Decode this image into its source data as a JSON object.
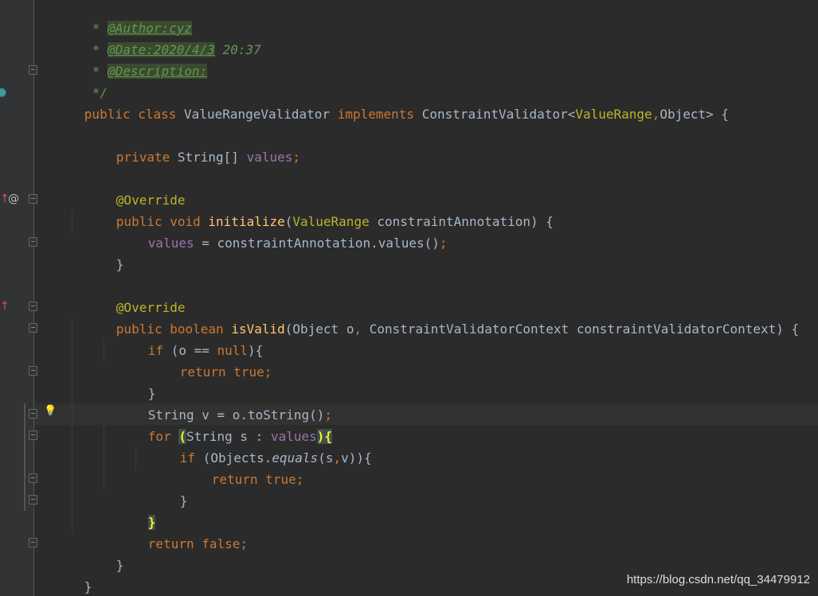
{
  "editor": {
    "doc": {
      "star": "*",
      "author_tag": "@Author:cyz",
      "date_tag": "@Date:2020/4/3",
      "date_time": " 20:37",
      "desc_tag": "@Description:",
      "close": "*/"
    },
    "class_decl": {
      "public": "public",
      "class": "class",
      "name": "ValueRangeValidator",
      "implements": "implements",
      "iface": "ConstraintValidator",
      "lt": "<",
      "type1": "ValueRange",
      "comma": ",",
      "type2": "Object",
      "gt_brace": "> {"
    },
    "field": {
      "private": "private",
      "type": "String[]",
      "name": "values",
      "semi": ";"
    },
    "override": "@Override",
    "init": {
      "public": "public",
      "void": "void",
      "name": "initialize",
      "open": "(",
      "ptype": "ValueRange",
      "pname": "constraintAnnotation",
      "close": ") {"
    },
    "assign": {
      "lhs": "values",
      "eq": " = ",
      "rhs": "constraintAnnotation.values()",
      "semi": ";"
    },
    "close_brace": "}",
    "isvalid": {
      "public": "public",
      "boolean": "boolean",
      "name": "isValid",
      "open": "(Object o",
      "comma": ",",
      "rest": " ConstraintValidatorContext constraintValidatorContext) {"
    },
    "if_null": {
      "if": "if",
      "cond_a": " (o == ",
      "null": "null",
      "cond_b": "){"
    },
    "return_true": {
      "return": "return",
      "true": "true",
      "semi": ";"
    },
    "string_v": {
      "code": "String v = o.toString()",
      "semi": ";"
    },
    "for_stmt": {
      "for": "for",
      "open_paren": "(",
      "decl": "String s : ",
      "values": "values",
      "close_paren": ")",
      "brace": "{"
    },
    "if_eq": {
      "if": "if",
      "a": " (Objects.",
      "equals": "equals",
      "b": "(s",
      "comma": ",",
      "c": "v)){"
    },
    "return_false": {
      "return": "return",
      "false": "false",
      "semi": ";"
    },
    "icons": {
      "implements_marker": "implements-marker-icon",
      "override_up": "override-arrow-icon",
      "at_marker": "annotation-at-icon",
      "bulb": "lightbulb-icon",
      "fold": "fold-marker-icon"
    },
    "colors": {
      "background": "#2b2b2b",
      "gutter": "#313335",
      "keyword": "#cc7832",
      "method": "#ffc66d",
      "field": "#9876aa",
      "annotation": "#bbb529",
      "doc": "#629755",
      "text": "#a9b7c6"
    }
  },
  "watermark": "https://blog.csdn.net/qq_34479912"
}
